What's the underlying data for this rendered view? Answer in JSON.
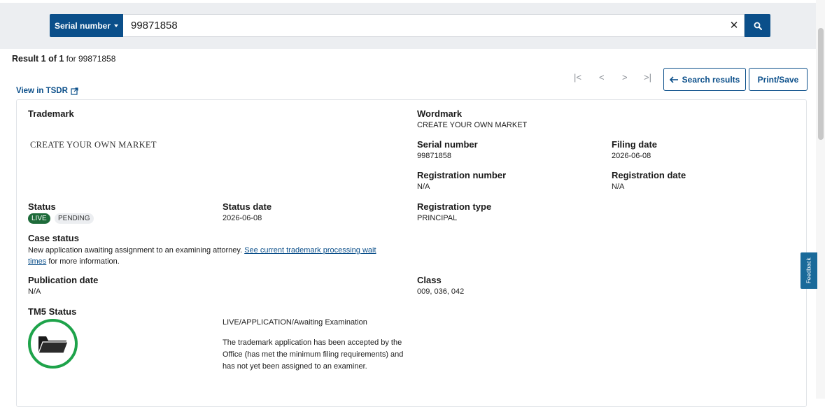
{
  "search": {
    "field_label": "Serial number",
    "query": "99871858"
  },
  "result": {
    "count_text": "Result 1 of 1",
    "for_text": "for 99871858"
  },
  "pager": {
    "first": "|<",
    "prev": "<",
    "next": ">",
    "last": ">|"
  },
  "actions": {
    "search_results": "Search results",
    "print_save": "Print/Save",
    "view_tsdr": "View in TSDR"
  },
  "details": {
    "trademark_label": "Trademark",
    "mark_text": "CREATE YOUR OWN MARKET",
    "wordmark_label": "Wordmark",
    "wordmark_value": "CREATE YOUR OWN MARKET",
    "serial_label": "Serial number",
    "serial_value": "99871858",
    "filing_date_label": "Filing date",
    "filing_date_value": "2026-06-08",
    "reg_number_label": "Registration number",
    "reg_number_value": "N/A",
    "reg_date_label": "Registration date",
    "reg_date_value": "N/A",
    "status_label": "Status",
    "status_live": "LIVE",
    "status_pending": "PENDING",
    "status_date_label": "Status date",
    "status_date_value": "2026-06-08",
    "reg_type_label": "Registration type",
    "reg_type_value": "PRINCIPAL",
    "case_status_label": "Case status",
    "case_status_text": "New application awaiting assignment to an examining attorney.",
    "case_status_link_1": "See current trademark processing wait",
    "case_status_link_2": "times",
    "case_status_tail": "for more information.",
    "pub_date_label": "Publication date",
    "pub_date_value": "N/A",
    "class_label": "Class",
    "class_value": "009, 036, 042",
    "tm5_label": "TM5 Status",
    "tm5_status": "LIVE/APPLICATION/Awaiting Examination",
    "tm5_description": "The trademark application has been accepted by the Office (has met the minimum filing requirements) and has not yet been assigned to an examiner."
  },
  "feedback_label": "Feedback",
  "colors": {
    "primary": "#0b4f8a",
    "live": "#1e6b3a",
    "tm5_ring": "#1ea34a"
  },
  "icons": {
    "search": "search-icon",
    "clear": "close-icon",
    "external": "external-link-icon",
    "arrow_left": "arrow-left-icon",
    "folder": "folder-icon"
  }
}
